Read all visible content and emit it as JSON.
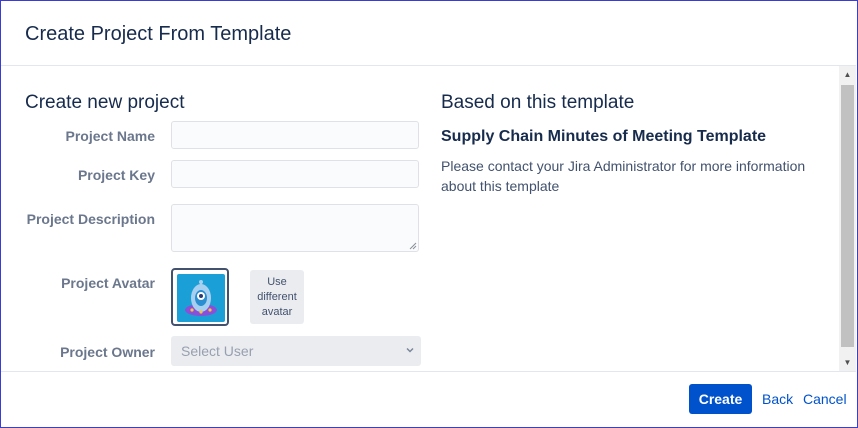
{
  "dialog": {
    "title": "Create Project From Template"
  },
  "form": {
    "heading": "Create new project",
    "project_name": {
      "label": "Project Name",
      "value": ""
    },
    "project_key": {
      "label": "Project Key",
      "value": ""
    },
    "project_description": {
      "label": "Project Description",
      "value": ""
    },
    "project_avatar": {
      "label": "Project Avatar",
      "change_button": "Use different avatar"
    },
    "project_owner": {
      "label": "Project Owner",
      "placeholder": "Select User"
    }
  },
  "template": {
    "heading": "Based on this template",
    "name": "Supply Chain Minutes of Meeting Template",
    "description": "Please contact your Jira Administrator for more information about this template"
  },
  "footer": {
    "create": "Create",
    "back": "Back",
    "cancel": "Cancel"
  },
  "colors": {
    "primary": "#0052cc",
    "title_text": "#172b4d",
    "label_text": "#6b778c",
    "avatar_bg": "#1aa0d6"
  },
  "icons": {
    "avatar": "robot-avatar-icon",
    "owner_caret": "chevron-down-icon",
    "scroll_up": "arrow-up-icon",
    "scroll_down": "arrow-down-icon"
  }
}
